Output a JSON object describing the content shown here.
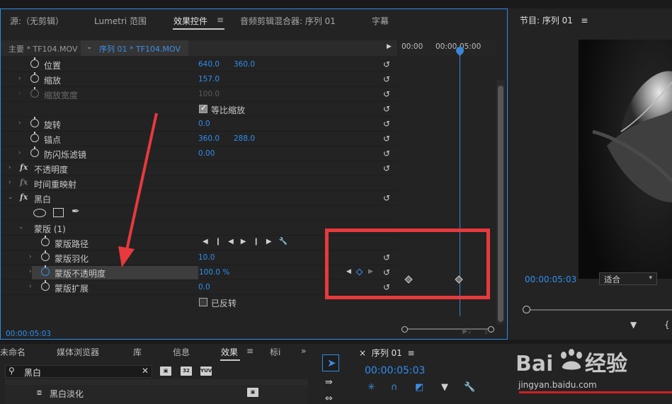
{
  "effect_controls": {
    "tabs": [
      "源:（无剪辑）",
      "Lumetri 范围",
      "效果控件",
      "音频剪辑混合器: 序列 01",
      "字幕"
    ],
    "menu_glyph": "≡",
    "source_clip": "主要 * TF104.MOV",
    "sequence_clip": "序列 01 * TF104.MOV",
    "play_glyph": "▶",
    "reset_glyph": "↺",
    "rows": {
      "position": {
        "label": "位置",
        "v1": "640.0",
        "v2": "360.0"
      },
      "scale": {
        "label": "缩放",
        "v1": "157.0"
      },
      "scale_width": {
        "label": "缩放宽度",
        "v1": "100.0"
      },
      "uniform_scale": {
        "label": "等比缩放"
      },
      "rotation": {
        "label": "旋转",
        "v1": "0.0"
      },
      "anchor": {
        "label": "锚点",
        "v1": "360.0",
        "v2": "288.0"
      },
      "anti_flicker": {
        "label": "防闪烁滤镜",
        "v1": "0.00"
      },
      "opacity": {
        "label": "不透明度"
      },
      "time_remap": {
        "label": "时间重映射"
      },
      "black_white": {
        "label": "黑白"
      },
      "mask_group": {
        "label": "蒙版 (1)"
      },
      "mask_path": {
        "label": "蒙版路径"
      },
      "mask_feather": {
        "label": "蒙版羽化",
        "v1": "10.0"
      },
      "mask_opacity": {
        "label": "蒙版不透明度",
        "v1": "100.0 %"
      },
      "mask_expansion": {
        "label": "蒙版扩展",
        "v1": "0.0"
      },
      "inverted": {
        "label": "已反转"
      }
    },
    "fx_glyph": "fx",
    "timeline": {
      "tick_left": "00:00",
      "tick_mid": "00:00",
      "tick_right": "05:00",
      "playhead_fraction": 0.62
    },
    "timecode": "00:00:05:03"
  },
  "program_monitor": {
    "title": "节目: 序列 01",
    "menu_glyph": "≡",
    "timecode": "00:00:05:03",
    "fit_label": "适合",
    "dropdown_glyph": "▾"
  },
  "project_panel": {
    "tabs": [
      "未命名",
      "媒体浏览器",
      "库",
      "信息",
      "效果",
      "标i"
    ],
    "more_glyph": "»",
    "search_value": "黑白",
    "clear_glyph": "✕",
    "icons": [
      "32",
      "YUV"
    ],
    "item": "黑白淡化"
  },
  "timeline_panel": {
    "close_glyph": "×",
    "title": "序列 01",
    "menu_glyph": "≡",
    "timecode": "00:00:05:03"
  },
  "watermark": {
    "brand": "Bai",
    "brand2": "du",
    "cn": "经验",
    "url": "jingyan.baidu.com"
  }
}
